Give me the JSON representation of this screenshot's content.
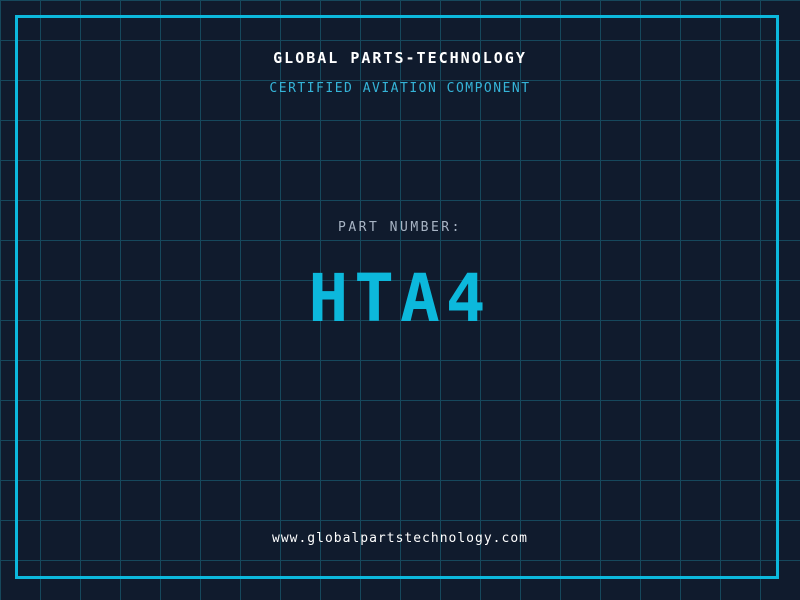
{
  "header": {
    "title": "GLOBAL PARTS-TECHNOLOGY",
    "subtitle": "CERTIFIED AVIATION COMPONENT"
  },
  "part": {
    "label": "PART NUMBER:",
    "number": "HTA4"
  },
  "footer": {
    "website": "www.globalpartstechnology.com"
  },
  "colors": {
    "background": "#101b2d",
    "grid_line": "#16485c",
    "frame_accent": "#0cb8dc",
    "subtitle_accent": "#35b4d8",
    "part_label_text": "#a8b4c4",
    "primary_text": "#ffffff"
  }
}
